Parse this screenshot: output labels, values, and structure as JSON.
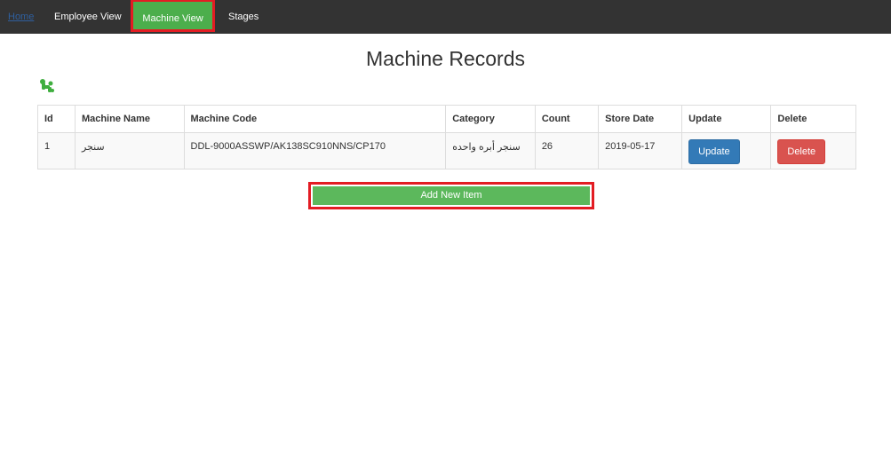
{
  "nav": {
    "home": "Home",
    "employee_view": "Employee View",
    "machine_view": "Machine View",
    "stages": "Stages"
  },
  "page_title": "Machine Records",
  "logo_icon": "green-puzzle-logo-icon",
  "table": {
    "headers": [
      "Id",
      "Machine Name",
      "Machine Code",
      "Category",
      "Count",
      "Store Date",
      "Update",
      "Delete"
    ],
    "rows": [
      {
        "id": "1",
        "machine_name": "سنجر",
        "machine_code": "DDL-9000ASSWP/AK138SC910NNS/CP170",
        "category": "سنجر أبره واحده",
        "count": "26",
        "store_date": "2019-05-17",
        "update_label": "Update",
        "delete_label": "Delete"
      }
    ]
  },
  "add_button": "Add New Item",
  "colors": {
    "navbar": "#333333",
    "active_tab": "#4cae4c",
    "highlight": "#e31c23",
    "update": "#337ab7",
    "delete": "#d9534f",
    "add": "#5cb85c"
  }
}
